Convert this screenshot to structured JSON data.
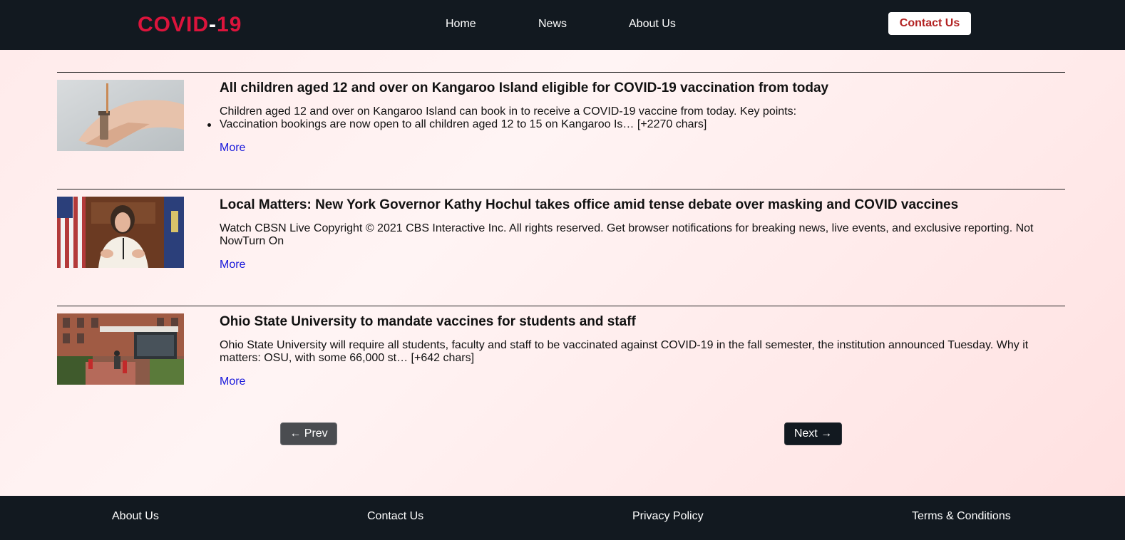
{
  "header": {
    "logo_main": "COVID",
    "logo_dash": "-",
    "logo_num": "19",
    "nav": [
      "Home",
      "News",
      "About Us"
    ],
    "contact_label": "Contact Us"
  },
  "articles": [
    {
      "title": "All children aged 12 and over on Kangaroo Island eligible for COVID-19 vaccination from today",
      "desc": "Children aged 12 and over on Kangaroo Island can book in to receive a COVID-19 vaccine from today. Key points:",
      "bullet": "Vaccination bookings are now open to all children aged 12 to 15 on Kangaroo Is… [+2270 chars]",
      "more": "More",
      "image": "vaccine-vial-photo"
    },
    {
      "title": "Local Matters: New York Governor Kathy Hochul takes office amid tense debate over masking and COVID vaccines",
      "desc": "Watch CBSN Live Copyright © 2021 CBS Interactive Inc. All rights reserved. Get browser notifications for breaking news, live events, and exclusive reporting. Not NowTurn On",
      "more": "More",
      "image": "governor-press-conference-photo"
    },
    {
      "title": "Ohio State University to mandate vaccines for students and staff",
      "desc": "Ohio State University will require all students, faculty and staff to be vaccinated against COVID-19 in the fall semester, the institution announced Tuesday. Why it matters: OSU, with some 66,000 st… [+642 chars]",
      "more": "More",
      "image": "campus-building-photo"
    }
  ],
  "pagination": {
    "prev": "← Prev",
    "next": "Next →"
  },
  "footer": {
    "links": [
      "About Us",
      "Contact Us",
      "Privacy Policy",
      "Terms & Conditions"
    ]
  },
  "colors": {
    "nav_bg": "#121920",
    "logo_red": "#dc143c",
    "link_blue": "#1a1adb",
    "contact_text": "#b22222"
  }
}
